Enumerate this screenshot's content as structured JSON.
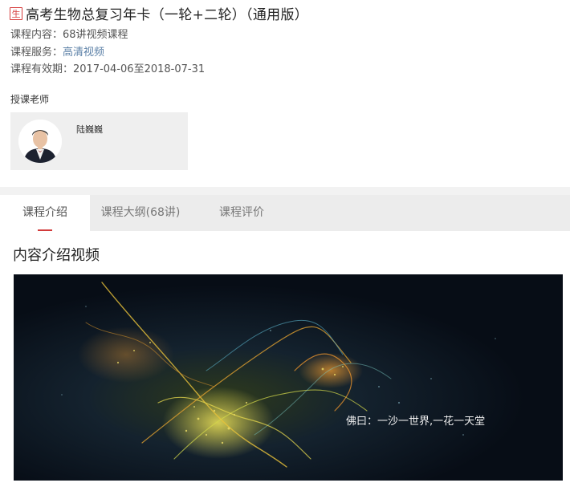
{
  "course": {
    "badge": "生",
    "title": "高考生物总复习年卡（一轮+二轮）（通用版）"
  },
  "info": {
    "content_label": "课程内容：",
    "content_value": "68讲视频课程",
    "service_label": "课程服务：",
    "service_value": "高清视频",
    "validity_label": "课程有效期：",
    "validity_value": "2017-04-06至2018-07-31"
  },
  "teachers": {
    "section_label": "授课老师",
    "items": [
      {
        "name": "陆巍巍"
      }
    ]
  },
  "tabs": [
    {
      "label": "课程介绍",
      "active": true
    },
    {
      "label": "课程大纲(68讲)",
      "active": false
    },
    {
      "label": "课程评价",
      "active": false
    }
  ],
  "intro": {
    "heading": "内容介绍视频",
    "video_caption": "佛曰：一沙一世界,一花一天堂"
  },
  "colors": {
    "accent_red": "#d23a3a",
    "link_blue": "#5a7fa6",
    "tab_bar": "#ececec"
  }
}
